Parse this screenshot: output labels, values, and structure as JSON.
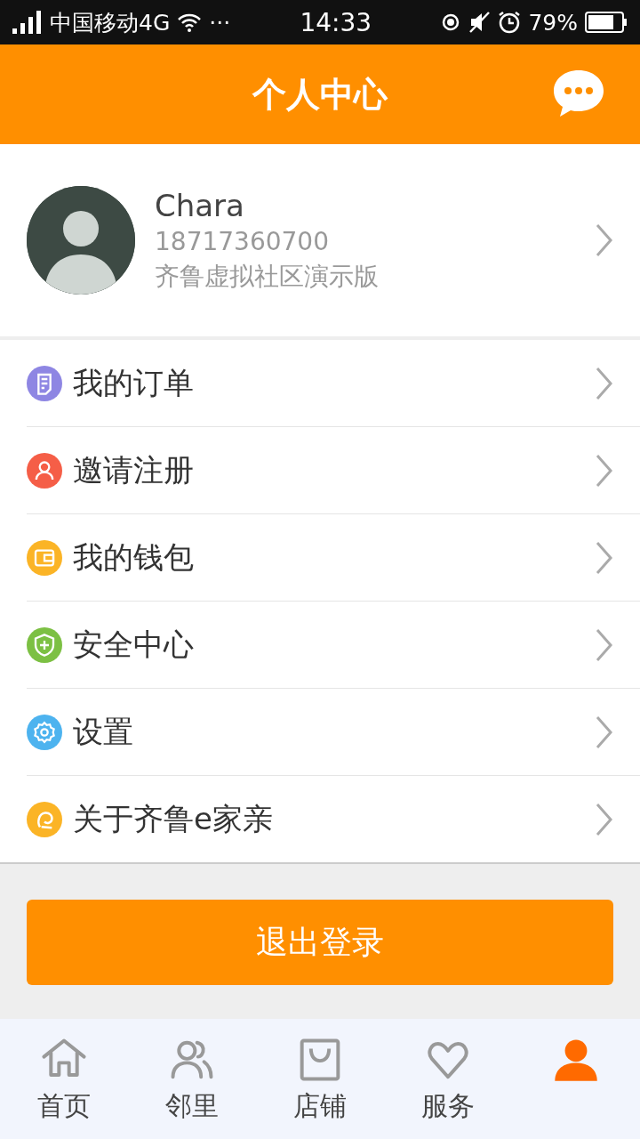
{
  "status_bar": {
    "carrier": "中国移动4G",
    "more": "···",
    "time": "14:33",
    "battery": "79%"
  },
  "header": {
    "title": "个人中心"
  },
  "profile": {
    "name": "Chara",
    "phone": "18717360700",
    "community": "齐鲁虚拟社区演示版"
  },
  "menu": [
    {
      "label": "我的订单",
      "kind": "document",
      "color": "#8e86e3"
    },
    {
      "label": "邀请注册",
      "kind": "person",
      "color": "#f55e47"
    },
    {
      "label": "我的钱包",
      "kind": "wallet",
      "color": "#fbb426"
    },
    {
      "label": "安全中心",
      "kind": "shield",
      "color": "#7cc043"
    },
    {
      "label": "设置",
      "kind": "gear",
      "color": "#4db3ef"
    },
    {
      "label": "关于齐鲁e家亲",
      "kind": "logo",
      "color": "#fbb426"
    }
  ],
  "logout_button": "退出登录",
  "tabs": [
    {
      "label": "首页",
      "kind": "home",
      "selected": false
    },
    {
      "label": "邻里",
      "kind": "people",
      "selected": false
    },
    {
      "label": "店铺",
      "kind": "bag",
      "selected": false
    },
    {
      "label": "服务",
      "kind": "heart",
      "selected": false
    },
    {
      "kind": "person",
      "selected": true
    }
  ]
}
